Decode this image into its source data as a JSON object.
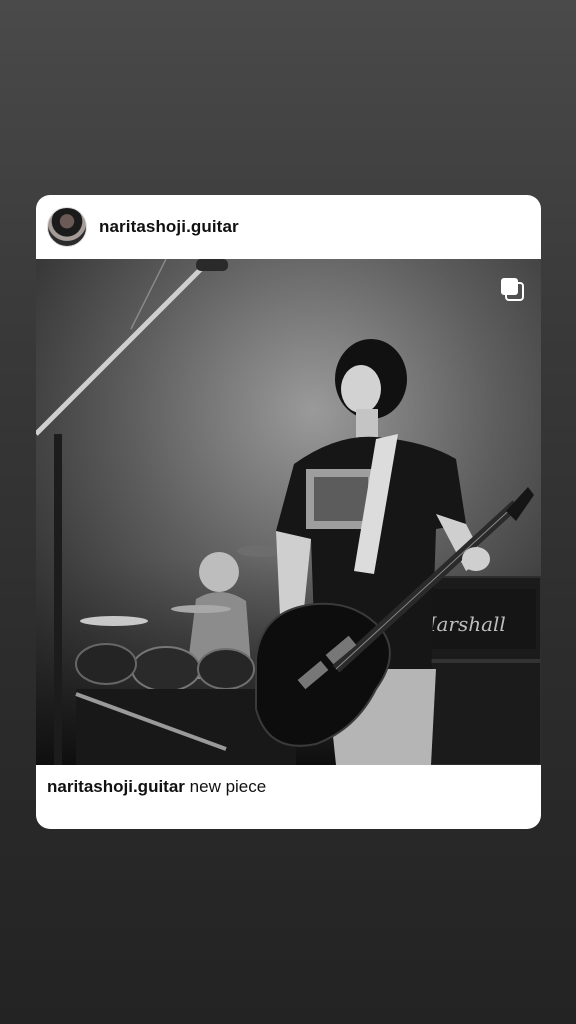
{
  "post": {
    "username": "naritashoji.guitar",
    "caption_username": "naritashoji.guitar",
    "caption_text": "new piece",
    "photo_alt": "",
    "amp_brand": "Marshall"
  },
  "icons": {
    "avatar": "profile-avatar",
    "multi": "carousel-multiple-photos-icon"
  },
  "colors": {
    "card_bg": "#ffffff",
    "text": "#111111"
  }
}
